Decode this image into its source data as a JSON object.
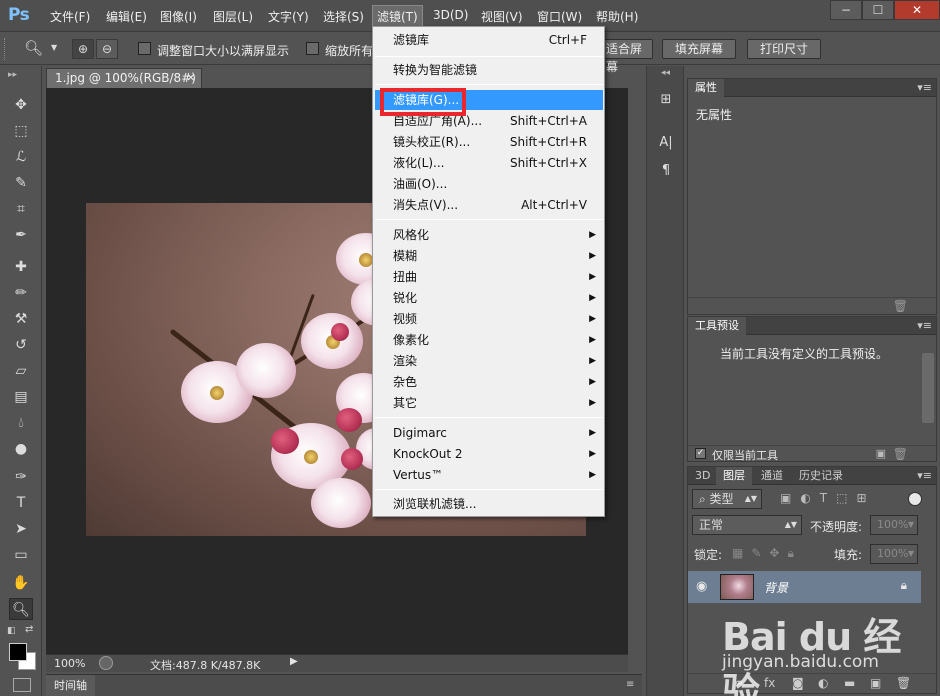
{
  "app": {
    "logo": "Ps"
  },
  "menubar": {
    "items": [
      "文件(F)",
      "编辑(E)",
      "图像(I)",
      "图层(L)",
      "文字(Y)",
      "选择(S)",
      "滤镜(T)",
      "3D(D)",
      "视图(V)",
      "窗口(W)",
      "帮助(H)"
    ],
    "active": "滤镜(T)",
    "window_controls": [
      "−",
      "☐",
      "✕"
    ]
  },
  "options_bar": {
    "resize_windows_label": "调整窗口大小以满屏显示",
    "zoom_all_label": "缩放所有",
    "fit_screen_label": "适合屏幕",
    "fill_screen_label": "填充屏幕",
    "print_size_label": "打印尺寸"
  },
  "document": {
    "tab_title": "1.jpg @ 100%(RGB/8#)",
    "tab_close": "✕",
    "zoom": "100%",
    "doc_info": "文档:487.8 K/487.8K"
  },
  "filter_menu": {
    "top_items": [
      {
        "label": "滤镜库",
        "shortcut": "Ctrl+F"
      }
    ],
    "smart": [
      {
        "label": "转换为智能滤镜"
      }
    ],
    "main_items": [
      {
        "label": "滤镜库(G)...",
        "shortcut": ""
      },
      {
        "label": "自适应广角(A)...",
        "shortcut": "Shift+Ctrl+A"
      },
      {
        "label": "镜头校正(R)...",
        "shortcut": "Shift+Ctrl+R"
      },
      {
        "label": "液化(L)...",
        "shortcut": "Shift+Ctrl+X"
      },
      {
        "label": "油画(O)...",
        "shortcut": ""
      },
      {
        "label": "消失点(V)...",
        "shortcut": "Alt+Ctrl+V"
      }
    ],
    "submenus": [
      "风格化",
      "模糊",
      "扭曲",
      "锐化",
      "视频",
      "像素化",
      "渲染",
      "杂色",
      "其它"
    ],
    "plugins": [
      "Digimarc",
      "KnockOut 2",
      "Vertus™"
    ],
    "browse": "浏览联机滤镜..."
  },
  "properties_panel": {
    "tab": "属性",
    "content": "无属性"
  },
  "tool_presets_panel": {
    "tab": "工具预设",
    "content": "当前工具没有定义的工具预设。",
    "current_tool_only": "仅限当前工具"
  },
  "layers_panel": {
    "tabs": [
      "3D",
      "图层",
      "通道",
      "历史记录"
    ],
    "active_tab": "图层",
    "filter_kind": "类型",
    "blend_mode": "正常",
    "opacity_label": "不透明度:",
    "opacity_value": "100%",
    "lock_label": "锁定:",
    "fill_label": "填充:",
    "fill_value": "100%",
    "layers": [
      {
        "name": "背景"
      }
    ]
  },
  "timeline": {
    "label": "时间轴"
  },
  "watermark": {
    "logo": "Bai du 经验",
    "url": "jingyan.baidu.com"
  },
  "colors": {
    "highlight": "#3399ff",
    "callout": "#e8282c",
    "layer_selected": "#6e7e92"
  }
}
